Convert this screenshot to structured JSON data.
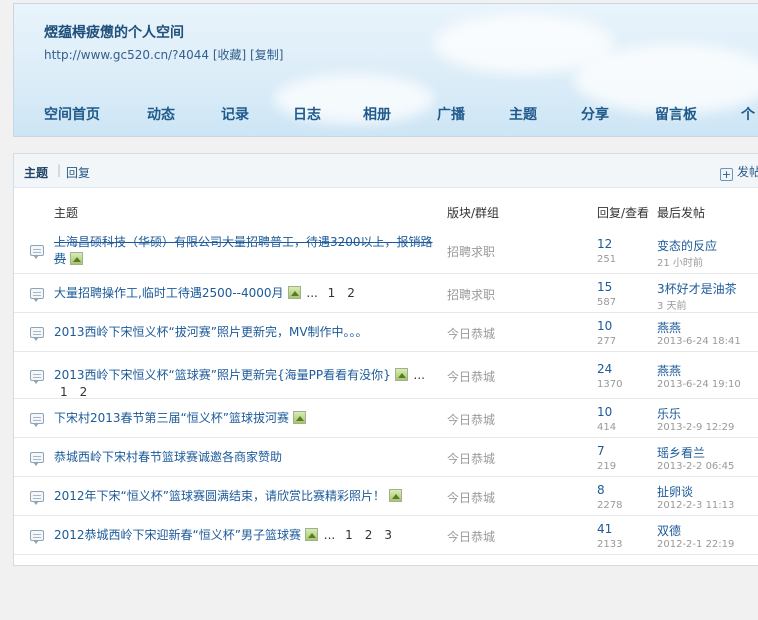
{
  "header": {
    "title": "熤蕴棏疲憊的个人空间",
    "url": "http://www.gc520.cn/?4044",
    "favorite_label": "[收藏]",
    "copy_label": "[复制]"
  },
  "nav": [
    {
      "label": "空间首页"
    },
    {
      "label": "动态"
    },
    {
      "label": "记录"
    },
    {
      "label": "日志"
    },
    {
      "label": "相册"
    },
    {
      "label": "广播"
    },
    {
      "label": "主题"
    },
    {
      "label": "分享"
    },
    {
      "label": "留言板"
    },
    {
      "label": "个"
    }
  ],
  "tabs": {
    "topic": "主题",
    "reply": "回复",
    "post_button": "发帖"
  },
  "columns": {
    "subject": "主题",
    "forum": "版块/群组",
    "stats": "回复/查看",
    "last_post": "最后发帖"
  },
  "threads": [
    {
      "title": "上海昌硕科技（华硕）有限公司大量招聘普工，待遇3200以上，报销路费",
      "strike": true,
      "has_image": true,
      "pages": [],
      "forum": "招聘求职",
      "replies": "12",
      "views": "251",
      "last_user": "变态的反应",
      "last_time": "21 小时前"
    },
    {
      "title": "大量招聘操作工,临时工待遇2500--4000月",
      "strike": false,
      "has_image": true,
      "pages": [
        "1",
        "2"
      ],
      "forum": "招聘求职",
      "replies": "15",
      "views": "587",
      "last_user": "3杯好才是油茶",
      "last_time": "3 天前"
    },
    {
      "title": "2013西岭下宋恒义杯“拔河赛”照片更新完，MV制作中。。。",
      "strike": false,
      "has_image": false,
      "pages": [],
      "forum": "今日恭城",
      "replies": "10",
      "views": "277",
      "last_user": "燕燕",
      "last_time": "2013-6-24 18:41"
    },
    {
      "title": "2013西岭下宋恒义杯“篮球赛”照片更新完{海量PP看看有没你}",
      "strike": false,
      "has_image": true,
      "pages": [
        "1",
        "2"
      ],
      "forum": "今日恭城",
      "replies": "24",
      "views": "1370",
      "last_user": "燕燕",
      "last_time": "2013-6-24 19:10"
    },
    {
      "title": "下宋村2013春节第三届“恒义杯”篮球拔河赛",
      "strike": false,
      "has_image": true,
      "pages": [],
      "forum": "今日恭城",
      "replies": "10",
      "views": "414",
      "last_user": "乐乐",
      "last_time": "2013-2-9 12:29"
    },
    {
      "title": "恭城西岭下宋村春节篮球赛诚邀各商家赞助",
      "strike": false,
      "has_image": false,
      "pages": [],
      "forum": "今日恭城",
      "replies": "7",
      "views": "219",
      "last_user": "瑶乡看兰",
      "last_time": "2013-2-2 06:45"
    },
    {
      "title": "2012年下宋“恒义杯”篮球赛圆满结束，请欣赏比赛精彩照片！",
      "strike": false,
      "has_image": true,
      "pages": [],
      "forum": "今日恭城",
      "replies": "8",
      "views": "2278",
      "last_user": "扯卵谈",
      "last_time": "2012-2-3 11:13"
    },
    {
      "title": "2012恭城西岭下宋迎新春“恒义杯”男子篮球赛",
      "strike": false,
      "has_image": true,
      "pages": [
        "1",
        "2",
        "3"
      ],
      "forum": "今日恭城",
      "replies": "41",
      "views": "2133",
      "last_user": "双德",
      "last_time": "2012-2-1 22:19"
    }
  ]
}
